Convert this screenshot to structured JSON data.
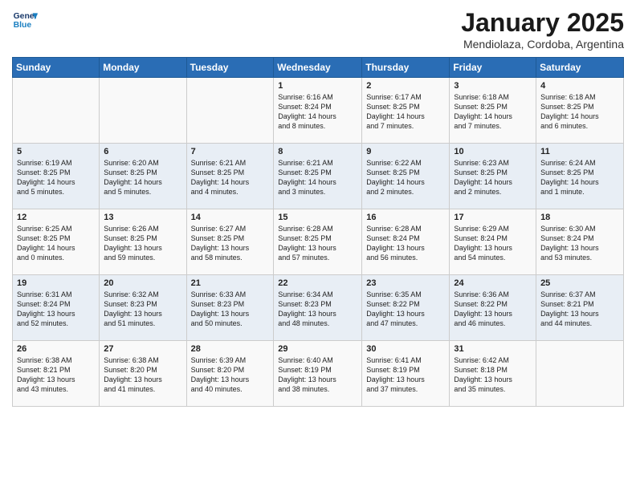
{
  "logo": {
    "line1": "General",
    "line2": "Blue"
  },
  "title": "January 2025",
  "location": "Mendiolaza, Cordoba, Argentina",
  "weekdays": [
    "Sunday",
    "Monday",
    "Tuesday",
    "Wednesday",
    "Thursday",
    "Friday",
    "Saturday"
  ],
  "weeks": [
    [
      {
        "day": "",
        "text": ""
      },
      {
        "day": "",
        "text": ""
      },
      {
        "day": "",
        "text": ""
      },
      {
        "day": "1",
        "text": "Sunrise: 6:16 AM\nSunset: 8:24 PM\nDaylight: 14 hours\nand 8 minutes."
      },
      {
        "day": "2",
        "text": "Sunrise: 6:17 AM\nSunset: 8:25 PM\nDaylight: 14 hours\nand 7 minutes."
      },
      {
        "day": "3",
        "text": "Sunrise: 6:18 AM\nSunset: 8:25 PM\nDaylight: 14 hours\nand 7 minutes."
      },
      {
        "day": "4",
        "text": "Sunrise: 6:18 AM\nSunset: 8:25 PM\nDaylight: 14 hours\nand 6 minutes."
      }
    ],
    [
      {
        "day": "5",
        "text": "Sunrise: 6:19 AM\nSunset: 8:25 PM\nDaylight: 14 hours\nand 5 minutes."
      },
      {
        "day": "6",
        "text": "Sunrise: 6:20 AM\nSunset: 8:25 PM\nDaylight: 14 hours\nand 5 minutes."
      },
      {
        "day": "7",
        "text": "Sunrise: 6:21 AM\nSunset: 8:25 PM\nDaylight: 14 hours\nand 4 minutes."
      },
      {
        "day": "8",
        "text": "Sunrise: 6:21 AM\nSunset: 8:25 PM\nDaylight: 14 hours\nand 3 minutes."
      },
      {
        "day": "9",
        "text": "Sunrise: 6:22 AM\nSunset: 8:25 PM\nDaylight: 14 hours\nand 2 minutes."
      },
      {
        "day": "10",
        "text": "Sunrise: 6:23 AM\nSunset: 8:25 PM\nDaylight: 14 hours\nand 2 minutes."
      },
      {
        "day": "11",
        "text": "Sunrise: 6:24 AM\nSunset: 8:25 PM\nDaylight: 14 hours\nand 1 minute."
      }
    ],
    [
      {
        "day": "12",
        "text": "Sunrise: 6:25 AM\nSunset: 8:25 PM\nDaylight: 14 hours\nand 0 minutes."
      },
      {
        "day": "13",
        "text": "Sunrise: 6:26 AM\nSunset: 8:25 PM\nDaylight: 13 hours\nand 59 minutes."
      },
      {
        "day": "14",
        "text": "Sunrise: 6:27 AM\nSunset: 8:25 PM\nDaylight: 13 hours\nand 58 minutes."
      },
      {
        "day": "15",
        "text": "Sunrise: 6:28 AM\nSunset: 8:25 PM\nDaylight: 13 hours\nand 57 minutes."
      },
      {
        "day": "16",
        "text": "Sunrise: 6:28 AM\nSunset: 8:24 PM\nDaylight: 13 hours\nand 56 minutes."
      },
      {
        "day": "17",
        "text": "Sunrise: 6:29 AM\nSunset: 8:24 PM\nDaylight: 13 hours\nand 54 minutes."
      },
      {
        "day": "18",
        "text": "Sunrise: 6:30 AM\nSunset: 8:24 PM\nDaylight: 13 hours\nand 53 minutes."
      }
    ],
    [
      {
        "day": "19",
        "text": "Sunrise: 6:31 AM\nSunset: 8:24 PM\nDaylight: 13 hours\nand 52 minutes."
      },
      {
        "day": "20",
        "text": "Sunrise: 6:32 AM\nSunset: 8:23 PM\nDaylight: 13 hours\nand 51 minutes."
      },
      {
        "day": "21",
        "text": "Sunrise: 6:33 AM\nSunset: 8:23 PM\nDaylight: 13 hours\nand 50 minutes."
      },
      {
        "day": "22",
        "text": "Sunrise: 6:34 AM\nSunset: 8:23 PM\nDaylight: 13 hours\nand 48 minutes."
      },
      {
        "day": "23",
        "text": "Sunrise: 6:35 AM\nSunset: 8:22 PM\nDaylight: 13 hours\nand 47 minutes."
      },
      {
        "day": "24",
        "text": "Sunrise: 6:36 AM\nSunset: 8:22 PM\nDaylight: 13 hours\nand 46 minutes."
      },
      {
        "day": "25",
        "text": "Sunrise: 6:37 AM\nSunset: 8:21 PM\nDaylight: 13 hours\nand 44 minutes."
      }
    ],
    [
      {
        "day": "26",
        "text": "Sunrise: 6:38 AM\nSunset: 8:21 PM\nDaylight: 13 hours\nand 43 minutes."
      },
      {
        "day": "27",
        "text": "Sunrise: 6:38 AM\nSunset: 8:20 PM\nDaylight: 13 hours\nand 41 minutes."
      },
      {
        "day": "28",
        "text": "Sunrise: 6:39 AM\nSunset: 8:20 PM\nDaylight: 13 hours\nand 40 minutes."
      },
      {
        "day": "29",
        "text": "Sunrise: 6:40 AM\nSunset: 8:19 PM\nDaylight: 13 hours\nand 38 minutes."
      },
      {
        "day": "30",
        "text": "Sunrise: 6:41 AM\nSunset: 8:19 PM\nDaylight: 13 hours\nand 37 minutes."
      },
      {
        "day": "31",
        "text": "Sunrise: 6:42 AM\nSunset: 8:18 PM\nDaylight: 13 hours\nand 35 minutes."
      },
      {
        "day": "",
        "text": ""
      }
    ]
  ]
}
